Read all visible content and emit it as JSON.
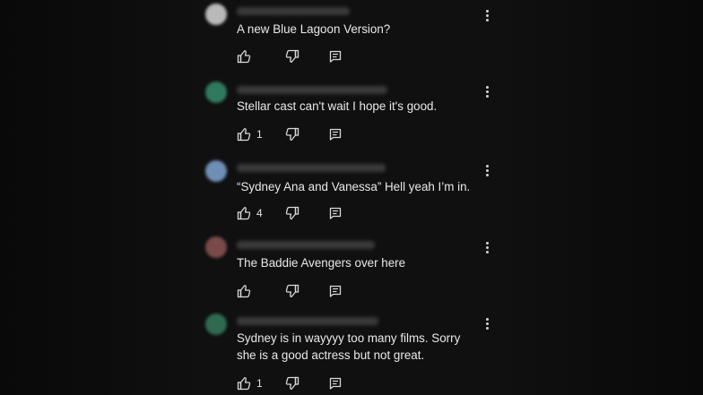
{
  "comments": [
    {
      "text": "A new Blue Lagoon Version?",
      "likes": "",
      "avatar_color": "#b9b9b9"
    },
    {
      "text": "Stellar cast can't wait I hope it's good.",
      "likes": "1",
      "avatar_color": "#2f7a5e"
    },
    {
      "text": "“Sydney Ana and Vanessa” Hell yeah I’m in.",
      "likes": "4",
      "avatar_color": "#6f8fb5"
    },
    {
      "text": "The Baddie Avengers over here",
      "likes": "",
      "avatar_color": "#7a4a4a"
    },
    {
      "text": "Sydney is in wayyyy too many films. Sorry she is a good actress but not great.",
      "likes": "1",
      "avatar_color": "#2f6a50"
    }
  ],
  "icons": {
    "like": "thumbs-up-icon",
    "dislike": "thumbs-down-icon",
    "reply": "reply-comment-icon",
    "more": "more-vertical-icon"
  }
}
